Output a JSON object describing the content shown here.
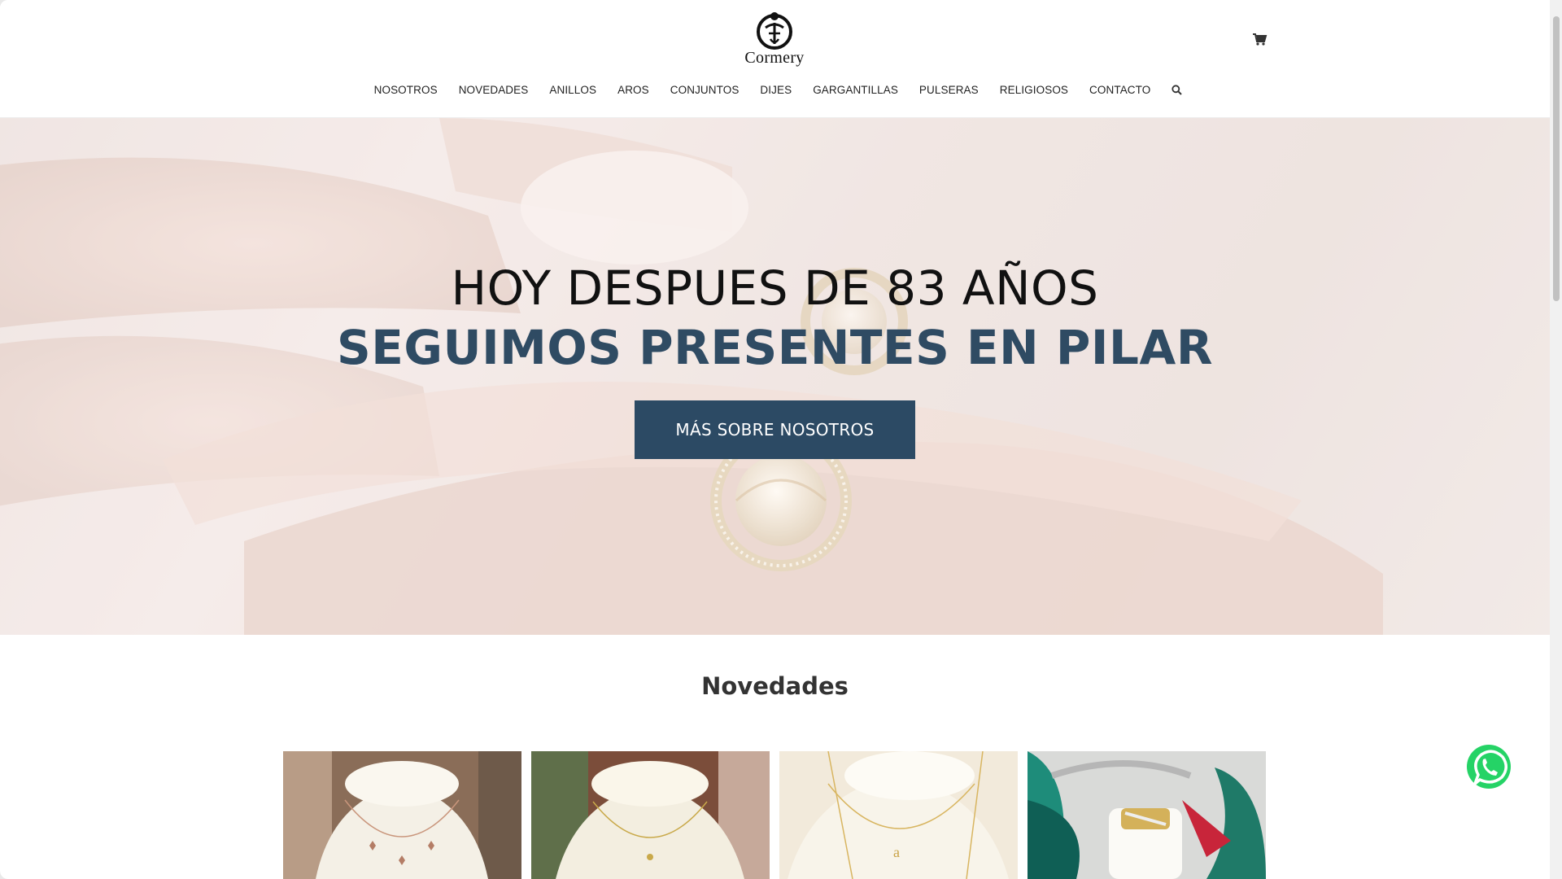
{
  "brand": {
    "name": "Cormery"
  },
  "nav": {
    "items": [
      "NOSOTROS",
      "NOVEDADES",
      "ANILLOS",
      "AROS",
      "CONJUNTOS",
      "DIJES",
      "GARGANTILLAS",
      "PULSERAS",
      "RELIGIOSOS",
      "CONTACTO"
    ]
  },
  "icons": {
    "cart": "cart-icon",
    "search": "search-icon",
    "whatsapp": "whatsapp-icon"
  },
  "hero": {
    "title": "HOY DESPUES DE 83 AÑOS",
    "subtitle": "SEGUIMOS PRESENTES EN PILAR",
    "button_label": "MÁS SOBRE NOSOTROS"
  },
  "novedades": {
    "title": "Novedades"
  },
  "colors": {
    "accent": "#2c4a64",
    "whatsapp": "#25d366",
    "text": "#222222"
  }
}
